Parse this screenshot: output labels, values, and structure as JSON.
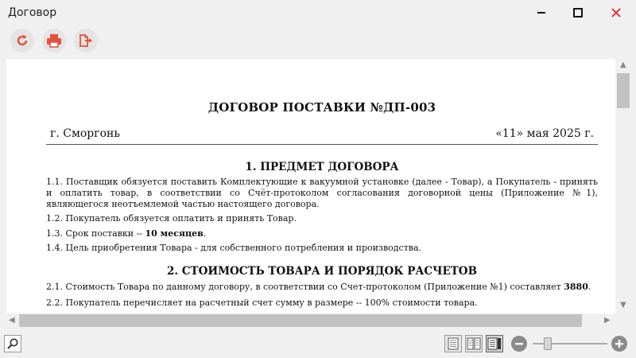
{
  "window": {
    "title": "Договор"
  },
  "toolbar": {
    "buttons": [
      {
        "name": "refresh",
        "icon": "refresh-icon"
      },
      {
        "name": "print",
        "icon": "printer-icon"
      },
      {
        "name": "export",
        "icon": "export-document-icon"
      }
    ]
  },
  "document": {
    "title": "ДОГОВОР ПОСТАВКИ №ДП-003",
    "city": "г. Сморгонь",
    "date": "«11» мая 2025 г.",
    "sections": [
      {
        "heading": "1. ПРЕДМЕТ ДОГОВОРА",
        "paragraphs": [
          "1.1. Поставщик обязуется поставить Комплектующие к вакуумной установке (далее - Товар), а Покупатель - принять и оплатить товар, в соответствии со Счёт-протоколом согласования договорной цены (Приложение №1), являющегося неотъемлемой частью настоящего договора.",
          "1.2. Покупатель обязуется оплатить и принять Товар."
        ],
        "p13_prefix": "1.3. Срок поставки -- ",
        "p13_bold": "10 месяцев",
        "p13_suffix": ".",
        "p14": "1.4. Цель приобретения Товара - для собственного потребления и производства."
      },
      {
        "heading": "2. СТОИМОСТЬ ТОВАРА И ПОРЯДОК РАСЧЕТОВ",
        "p21_prefix": "2.1. Стоимость Товара по данному договору, в соответствии со Счет-протоколом (Приложение №1) составляет ",
        "p21_bold": "3880",
        "p21_suffix": ".",
        "p22": "2.2. Покупатель перечисляет на расчетный счет сумму в размере -- 100% стоимости товара."
      }
    ]
  },
  "statusbar": {
    "search_icon": "search-icon",
    "view_modes": [
      "single-page-icon",
      "two-page-icon",
      "page-with-thumbnails-icon"
    ],
    "active_view_mode": "page-with-thumbnails-icon",
    "zoom_out_icon": "minus-icon",
    "zoom_in_icon": "plus-icon"
  },
  "colors": {
    "close": "#d9262b",
    "accent": "#e5503a"
  }
}
